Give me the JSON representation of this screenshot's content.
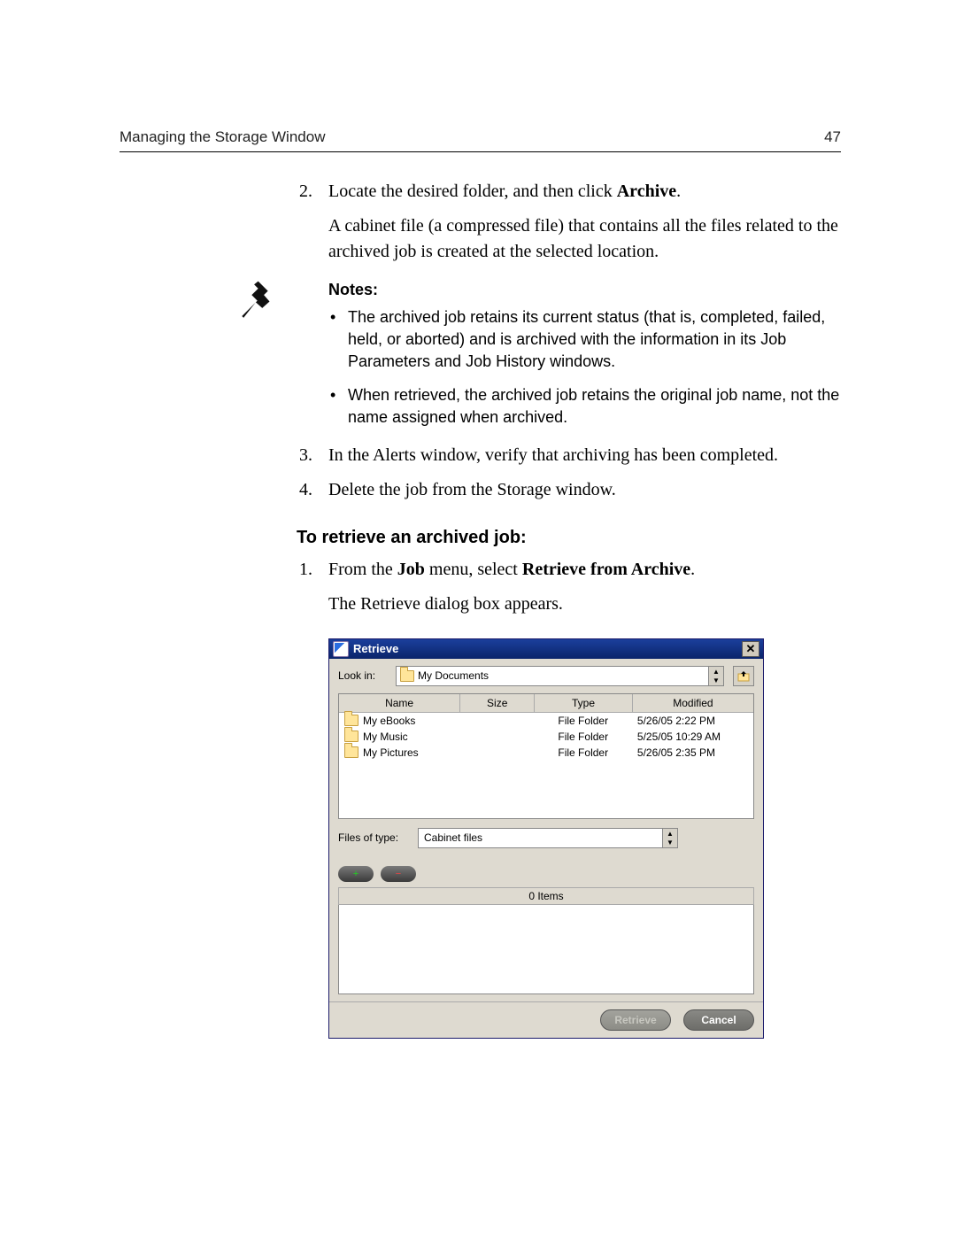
{
  "header": {
    "title": "Managing the Storage Window",
    "page_number": "47"
  },
  "step2": {
    "num": "2.",
    "text_a": "Locate the desired folder, and then click ",
    "bold": "Archive",
    "period": ".",
    "para": "A cabinet file (a compressed file) that contains all the files related to the archived job is created at the selected location."
  },
  "notes": {
    "heading": "Notes:",
    "items": [
      "The archived job retains its current status (that is, completed, failed, held, or aborted) and is archived with the information in its Job Parameters and Job History windows.",
      "When retrieved, the archived job retains the original job name, not the name assigned when archived."
    ]
  },
  "step3": {
    "num": "3.",
    "text": "In the Alerts window, verify that archiving has been completed."
  },
  "step4": {
    "num": "4.",
    "text": "Delete the job from the Storage window."
  },
  "retrieve": {
    "subhead": "To retrieve an archived job:",
    "step1": {
      "num": "1.",
      "a": "From the ",
      "b1": "Job",
      "mid": " menu, select ",
      "b2": "Retrieve from Archive",
      "end": "."
    },
    "para": "The Retrieve dialog box appears."
  },
  "dialog": {
    "title": "Retrieve",
    "lookin_label": "Look in:",
    "lookin_value": "My Documents",
    "columns": {
      "name": "Name",
      "size": "Size",
      "type": "Type",
      "modified": "Modified"
    },
    "rows": [
      {
        "name": "My eBooks",
        "size": "",
        "type": "File Folder",
        "modified": "5/26/05 2:22 PM"
      },
      {
        "name": "My Music",
        "size": "",
        "type": "File Folder",
        "modified": "5/25/05 10:29 AM"
      },
      {
        "name": "My Pictures",
        "size": "",
        "type": "File Folder",
        "modified": "5/26/05 2:35 PM"
      }
    ],
    "filter_label": "Files of type:",
    "filter_value": "Cabinet files",
    "items_count": "0 Items",
    "buttons": {
      "retrieve": "Retrieve",
      "cancel": "Cancel"
    },
    "add_symbol": "+",
    "remove_symbol": "−"
  }
}
